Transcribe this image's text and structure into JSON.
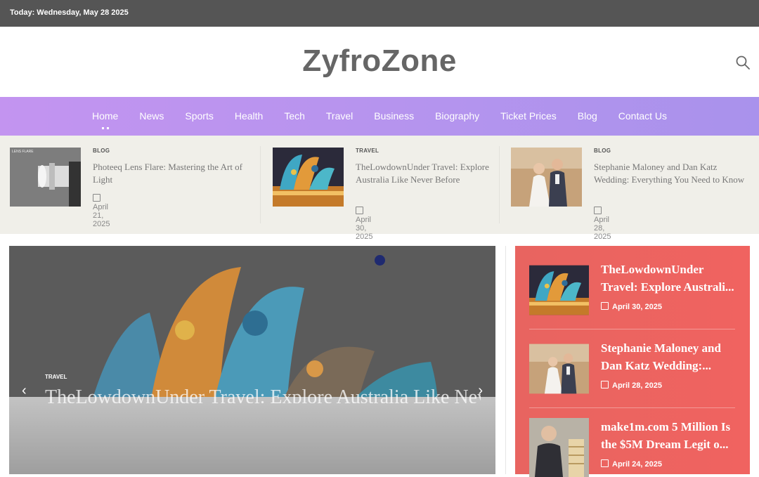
{
  "topbar": {
    "date": "Today: Wednesday, May 28 2025"
  },
  "header": {
    "logo": "ZyfroZone",
    "search_icon": "search-icon"
  },
  "nav": {
    "items": [
      "Home",
      "News",
      "Sports",
      "Health",
      "Tech",
      "Travel",
      "Business",
      "Biography",
      "Ticket Prices",
      "Blog",
      "Contact Us"
    ],
    "active": "Home"
  },
  "ticker": [
    {
      "category": "BLOG",
      "title": "Photeeq Lens Flare: Mastering the Art of Light",
      "date": "April 21, 2025",
      "thumb_label": "LENS FLARE"
    },
    {
      "category": "TRAVEL",
      "title": "TheLowdownUnder Travel: Explore Australia Like Never Before",
      "date": "April 30, 2025"
    },
    {
      "category": "BLOG",
      "title": "Stephanie Maloney and Dan Katz Wedding: Everything You Need to Know",
      "date": "April 28, 2025"
    }
  ],
  "hero": {
    "category": "TRAVEL",
    "title": "TheLowdownUnder Travel: Explore Australia Like Never Before",
    "prev_icon": "chevron-left-icon",
    "next_icon": "chevron-right-icon"
  },
  "sidebar": [
    {
      "title": "TheLowdownUnder Travel: Explore Australi...",
      "date": "April 30, 2025"
    },
    {
      "title": "Stephanie Maloney and Dan Katz Wedding:...",
      "date": "April 28, 2025"
    },
    {
      "title": "make1m.com 5 Million Is the $5M Dream Legit o...",
      "date": "April 24, 2025"
    }
  ],
  "colors": {
    "topbar": "#555555",
    "nav": "#b594ee",
    "ticker_bg": "#f0efe9",
    "sidebar": "#ee6360"
  }
}
